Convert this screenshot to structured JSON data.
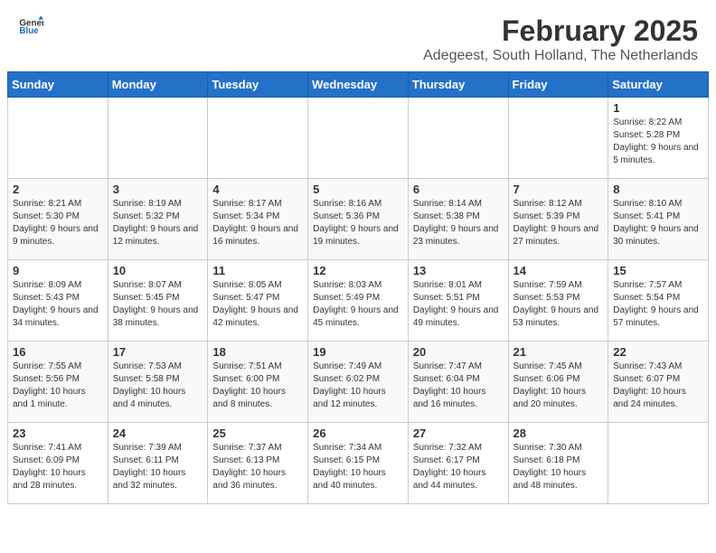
{
  "header": {
    "logo_general": "General",
    "logo_blue": "Blue",
    "month": "February 2025",
    "location": "Adegeest, South Holland, The Netherlands"
  },
  "weekdays": [
    "Sunday",
    "Monday",
    "Tuesday",
    "Wednesday",
    "Thursday",
    "Friday",
    "Saturday"
  ],
  "weeks": [
    [
      {
        "day": "",
        "info": ""
      },
      {
        "day": "",
        "info": ""
      },
      {
        "day": "",
        "info": ""
      },
      {
        "day": "",
        "info": ""
      },
      {
        "day": "",
        "info": ""
      },
      {
        "day": "",
        "info": ""
      },
      {
        "day": "1",
        "info": "Sunrise: 8:22 AM\nSunset: 5:28 PM\nDaylight: 9 hours and 5 minutes."
      }
    ],
    [
      {
        "day": "2",
        "info": "Sunrise: 8:21 AM\nSunset: 5:30 PM\nDaylight: 9 hours and 9 minutes."
      },
      {
        "day": "3",
        "info": "Sunrise: 8:19 AM\nSunset: 5:32 PM\nDaylight: 9 hours and 12 minutes."
      },
      {
        "day": "4",
        "info": "Sunrise: 8:17 AM\nSunset: 5:34 PM\nDaylight: 9 hours and 16 minutes."
      },
      {
        "day": "5",
        "info": "Sunrise: 8:16 AM\nSunset: 5:36 PM\nDaylight: 9 hours and 19 minutes."
      },
      {
        "day": "6",
        "info": "Sunrise: 8:14 AM\nSunset: 5:38 PM\nDaylight: 9 hours and 23 minutes."
      },
      {
        "day": "7",
        "info": "Sunrise: 8:12 AM\nSunset: 5:39 PM\nDaylight: 9 hours and 27 minutes."
      },
      {
        "day": "8",
        "info": "Sunrise: 8:10 AM\nSunset: 5:41 PM\nDaylight: 9 hours and 30 minutes."
      }
    ],
    [
      {
        "day": "9",
        "info": "Sunrise: 8:09 AM\nSunset: 5:43 PM\nDaylight: 9 hours and 34 minutes."
      },
      {
        "day": "10",
        "info": "Sunrise: 8:07 AM\nSunset: 5:45 PM\nDaylight: 9 hours and 38 minutes."
      },
      {
        "day": "11",
        "info": "Sunrise: 8:05 AM\nSunset: 5:47 PM\nDaylight: 9 hours and 42 minutes."
      },
      {
        "day": "12",
        "info": "Sunrise: 8:03 AM\nSunset: 5:49 PM\nDaylight: 9 hours and 45 minutes."
      },
      {
        "day": "13",
        "info": "Sunrise: 8:01 AM\nSunset: 5:51 PM\nDaylight: 9 hours and 49 minutes."
      },
      {
        "day": "14",
        "info": "Sunrise: 7:59 AM\nSunset: 5:53 PM\nDaylight: 9 hours and 53 minutes."
      },
      {
        "day": "15",
        "info": "Sunrise: 7:57 AM\nSunset: 5:54 PM\nDaylight: 9 hours and 57 minutes."
      }
    ],
    [
      {
        "day": "16",
        "info": "Sunrise: 7:55 AM\nSunset: 5:56 PM\nDaylight: 10 hours and 1 minute."
      },
      {
        "day": "17",
        "info": "Sunrise: 7:53 AM\nSunset: 5:58 PM\nDaylight: 10 hours and 4 minutes."
      },
      {
        "day": "18",
        "info": "Sunrise: 7:51 AM\nSunset: 6:00 PM\nDaylight: 10 hours and 8 minutes."
      },
      {
        "day": "19",
        "info": "Sunrise: 7:49 AM\nSunset: 6:02 PM\nDaylight: 10 hours and 12 minutes."
      },
      {
        "day": "20",
        "info": "Sunrise: 7:47 AM\nSunset: 6:04 PM\nDaylight: 10 hours and 16 minutes."
      },
      {
        "day": "21",
        "info": "Sunrise: 7:45 AM\nSunset: 6:06 PM\nDaylight: 10 hours and 20 minutes."
      },
      {
        "day": "22",
        "info": "Sunrise: 7:43 AM\nSunset: 6:07 PM\nDaylight: 10 hours and 24 minutes."
      }
    ],
    [
      {
        "day": "23",
        "info": "Sunrise: 7:41 AM\nSunset: 6:09 PM\nDaylight: 10 hours and 28 minutes."
      },
      {
        "day": "24",
        "info": "Sunrise: 7:39 AM\nSunset: 6:11 PM\nDaylight: 10 hours and 32 minutes."
      },
      {
        "day": "25",
        "info": "Sunrise: 7:37 AM\nSunset: 6:13 PM\nDaylight: 10 hours and 36 minutes."
      },
      {
        "day": "26",
        "info": "Sunrise: 7:34 AM\nSunset: 6:15 PM\nDaylight: 10 hours and 40 minutes."
      },
      {
        "day": "27",
        "info": "Sunrise: 7:32 AM\nSunset: 6:17 PM\nDaylight: 10 hours and 44 minutes."
      },
      {
        "day": "28",
        "info": "Sunrise: 7:30 AM\nSunset: 6:18 PM\nDaylight: 10 hours and 48 minutes."
      },
      {
        "day": "",
        "info": ""
      }
    ]
  ]
}
